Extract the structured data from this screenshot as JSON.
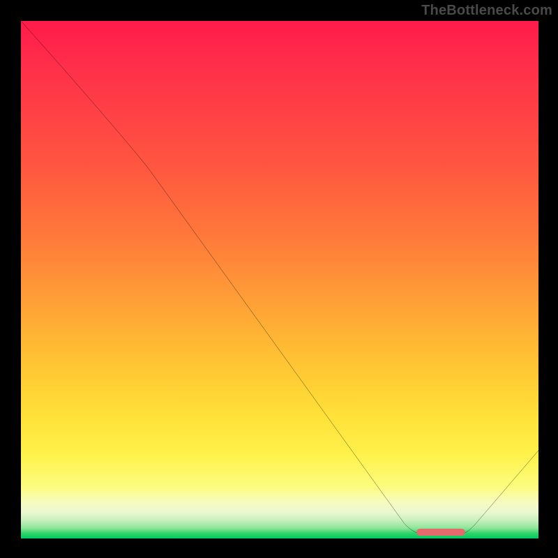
{
  "watermark": "TheBottleneck.com",
  "chart_data": {
    "type": "line",
    "title": "",
    "xlabel": "",
    "ylabel": "",
    "xlim": [
      0,
      100
    ],
    "ylim": [
      0,
      100
    ],
    "series": [
      {
        "name": "bottleneck-curve",
        "x": [
          0,
          22,
          78,
          84,
          100
        ],
        "y": [
          100,
          75,
          0,
          0,
          17
        ]
      }
    ],
    "annotations": [
      {
        "name": "optimal-range-marker",
        "x_start": 77,
        "x_end": 86,
        "y": 0.5
      }
    ],
    "background": {
      "type": "vertical-gradient",
      "stops": [
        {
          "pos": 0,
          "color": "#ff1b4a"
        },
        {
          "pos": 50,
          "color": "#ff9a38"
        },
        {
          "pos": 85,
          "color": "#fff24c"
        },
        {
          "pos": 100,
          "color": "#00c95f"
        }
      ]
    }
  }
}
